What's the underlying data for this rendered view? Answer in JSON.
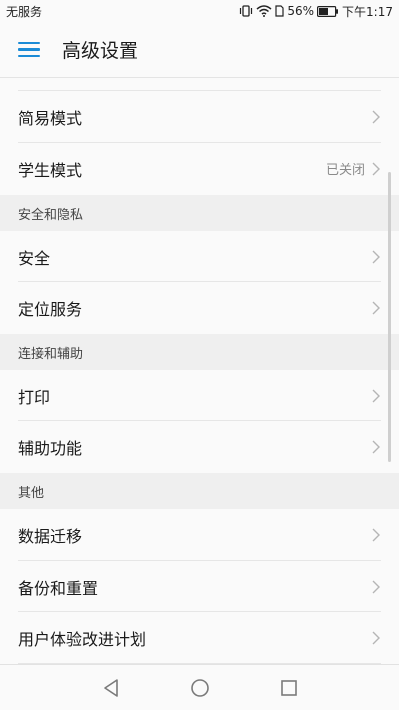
{
  "status_bar": {
    "carrier": "无服务",
    "battery": "56%",
    "time": "下午1:17"
  },
  "app_bar": {
    "title": "高级设置",
    "menu_icon": "menu-icon"
  },
  "items": {
    "simple_mode": {
      "label": "简易模式"
    },
    "student_mode": {
      "label": "学生模式",
      "value": "已关闭"
    },
    "security": {
      "label": "安全"
    },
    "location": {
      "label": "定位服务"
    },
    "print": {
      "label": "打印"
    },
    "accessibility": {
      "label": "辅助功能"
    },
    "data_migration": {
      "label": "数据迁移"
    },
    "backup_reset": {
      "label": "备份和重置"
    },
    "ux_program": {
      "label": "用户体验改进计划"
    }
  },
  "sections": {
    "security_privacy": "安全和隐私",
    "connection_assist": "连接和辅助",
    "other": "其他"
  },
  "nav": {
    "back_icon": "back-triangle-icon",
    "home_icon": "home-circle-icon",
    "recent_icon": "recent-square-icon"
  },
  "colors": {
    "accent": "#1b8bd6",
    "section_bg": "#efefef",
    "background": "#fafafa"
  }
}
